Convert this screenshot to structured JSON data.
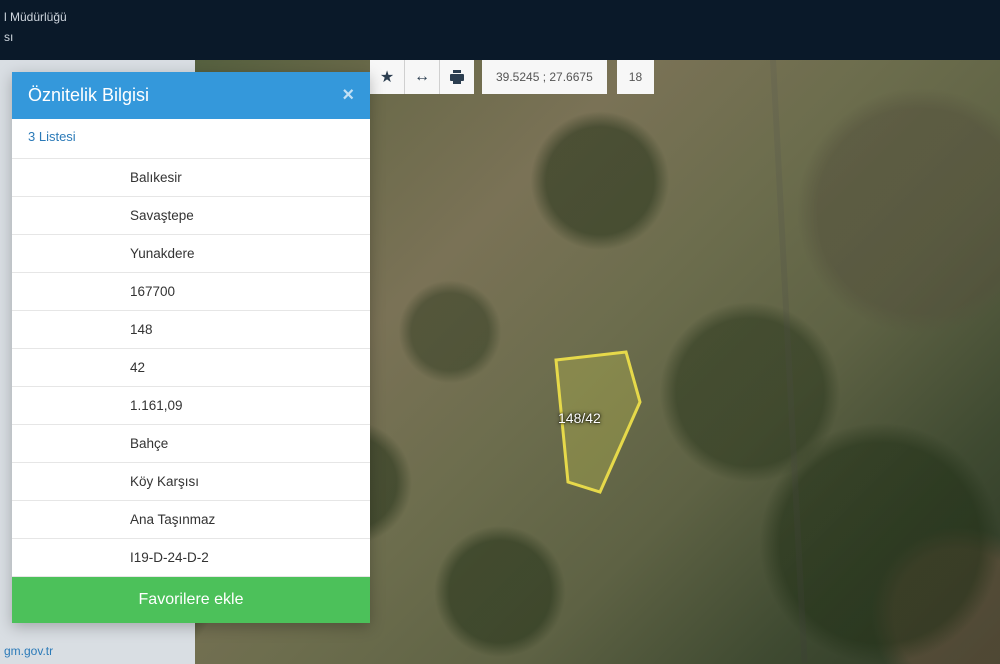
{
  "header": {
    "line1": "l Müdürlüğü",
    "line2": "sı"
  },
  "toolbar": {
    "star_icon": "star-icon",
    "measure_icon": "ruler-icon",
    "print_icon": "print-icon",
    "coords": "39.5245 ; 27.6675",
    "zoom": "18"
  },
  "modal": {
    "title": "Öznitelik Bilgisi",
    "tab": "3 Listesi",
    "rows": [
      "Balıkesir",
      "Savaştepe",
      "Yunakdere",
      "167700",
      "148",
      "42",
      "1.161,09",
      "Bahçe",
      "Köy Karşısı",
      "Ana Taşınmaz",
      "I19-D-24-D-2"
    ],
    "fav_button": "Favorilere ekle"
  },
  "map": {
    "parcel_label": "148/42"
  },
  "footer": {
    "link": "gm.gov.tr"
  }
}
